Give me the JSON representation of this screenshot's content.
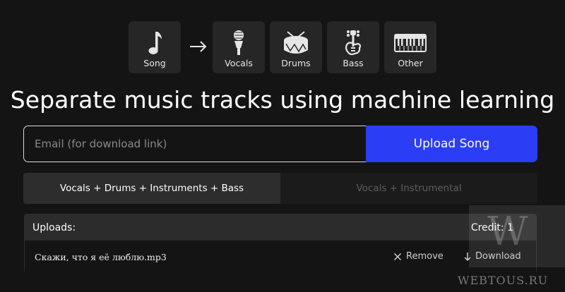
{
  "stems": {
    "items": [
      {
        "label": "Song",
        "icon": "music-note-icon"
      },
      {
        "label": "Vocals",
        "icon": "microphone-icon"
      },
      {
        "label": "Drums",
        "icon": "drum-icon"
      },
      {
        "label": "Bass",
        "icon": "bass-guitar-icon"
      },
      {
        "label": "Other",
        "icon": "keyboard-icon"
      }
    ],
    "arrow": "→"
  },
  "hero": {
    "title": "Separate music tracks using machine learning"
  },
  "upload": {
    "email_placeholder": "Email (for download link)",
    "email_value": "",
    "button_label": "Upload Song"
  },
  "mode": {
    "options": [
      "Vocals + Drums + Instruments + Bass",
      "Vocals + Instrumental"
    ],
    "selected": "Vocals + Drums + Instruments + Bass"
  },
  "uploads": {
    "header": "Uploads:",
    "credit": "Credit: 1",
    "files": [
      {
        "name": "Скажи, что я её люблю.mp3",
        "remove_label": "Remove",
        "download_label": "Download"
      }
    ]
  },
  "watermark": {
    "letter": "W",
    "text": "WEBTOUS.RU"
  },
  "colors": {
    "background": "#141414",
    "accent": "#2b3df5",
    "tile": "#262626"
  }
}
